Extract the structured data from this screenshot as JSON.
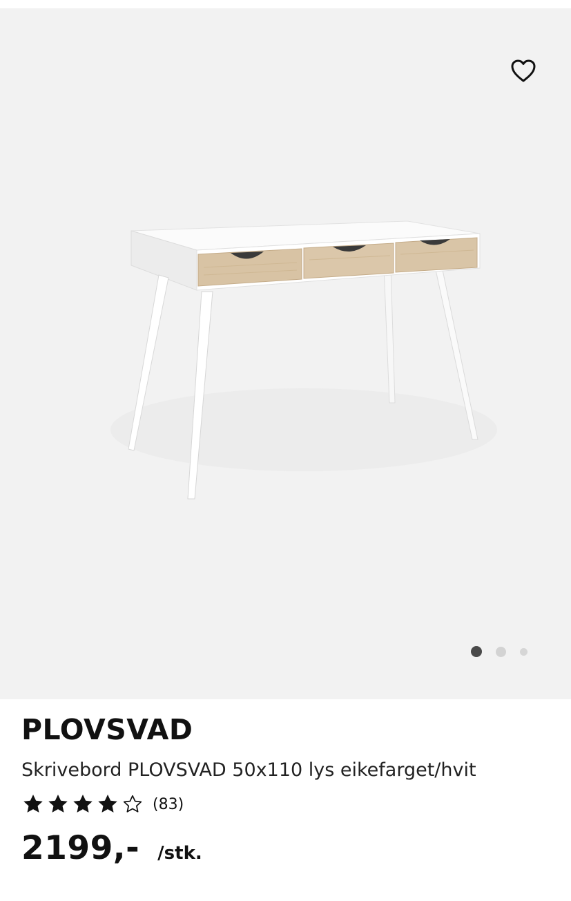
{
  "gallery": {
    "image_alt": "Skrivebord PLOVSVAD 50x110 lys eikefarget/hvit",
    "slide_count": 3,
    "active_slide": 1
  },
  "product": {
    "brand": "PLOVSVAD",
    "description": "Skrivebord PLOVSVAD 50x110 lys eikefarget/hvit",
    "rating": {
      "stars_filled": 4,
      "stars_total": 5,
      "count_label": "(83)"
    },
    "price": "2199,-",
    "unit": "/stk."
  },
  "icons": {
    "favorite": "heart-outline-icon",
    "star_filled": "star-filled-icon",
    "star_empty": "star-outline-icon"
  },
  "colors": {
    "gallery_bg": "#f2f2f2",
    "text": "#111111",
    "dot_active": "#4a4a4a",
    "dot_inactive": "#d3d3d3",
    "oak": "#d8c3a4"
  }
}
